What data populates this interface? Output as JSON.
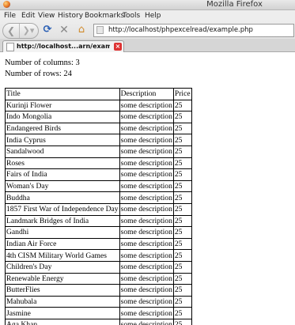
{
  "window": {
    "title": "Mozilla Firefox"
  },
  "menu": [
    {
      "label": "File",
      "key": "F"
    },
    {
      "label": "Edit",
      "key": "E"
    },
    {
      "label": "View",
      "key": "V"
    },
    {
      "label": "History",
      "key": "s"
    },
    {
      "label": "Bookmarks",
      "key": "B"
    },
    {
      "label": "Tools",
      "key": "T"
    },
    {
      "label": "Help",
      "key": "H"
    }
  ],
  "nav": {
    "back_icon": "back-arrow-icon",
    "forward_icon": "forward-arrow-icon",
    "reload_icon": "reload-icon",
    "stop_icon": "stop-icon",
    "home_icon": "home-icon",
    "url": "http://localhost/phpexcelread/example.php"
  },
  "tab": {
    "label": "http://localhost...arn/example.php",
    "close_icon": "close-icon"
  },
  "page": {
    "columns_line": "Number of columns: 3",
    "rows_line": "Number of rows: 24"
  },
  "table": {
    "headers": [
      "Title",
      "Description",
      "Price"
    ],
    "rows": [
      [
        "Kurinji Flower",
        "some description",
        "25"
      ],
      [
        "Indo Mongolia",
        "some description",
        "25"
      ],
      [
        "Endangered Birds",
        "some description",
        "25"
      ],
      [
        "India Cyprus",
        "some description",
        "25"
      ],
      [
        "Sandalwood",
        "some description",
        "25"
      ],
      [
        "Roses",
        "some description",
        "25"
      ],
      [
        "Fairs of India",
        "some description",
        "25"
      ],
      [
        "Woman's Day",
        "some description",
        "25"
      ],
      [
        "Buddha",
        "some description",
        "25"
      ],
      [
        "1857 First War of Independence Day",
        "some description",
        "25"
      ],
      [
        "Landmark Bridges of India",
        "some description",
        "25"
      ],
      [
        "Gandhi",
        "some description",
        "25"
      ],
      [
        "Indian Air Force",
        "some description",
        "25"
      ],
      [
        "4th CISM Military World Games",
        "some description",
        "25"
      ],
      [
        "Children's Day",
        "some description",
        "25"
      ],
      [
        "Renewable Energy",
        "some description",
        "25"
      ],
      [
        "ButterFlies",
        "some description",
        "25"
      ],
      [
        "Mahubala",
        "some description",
        "25"
      ],
      [
        "Jasmine",
        "some description",
        "25"
      ],
      [
        "Aga Khan",
        "some description",
        "25"
      ]
    ]
  }
}
